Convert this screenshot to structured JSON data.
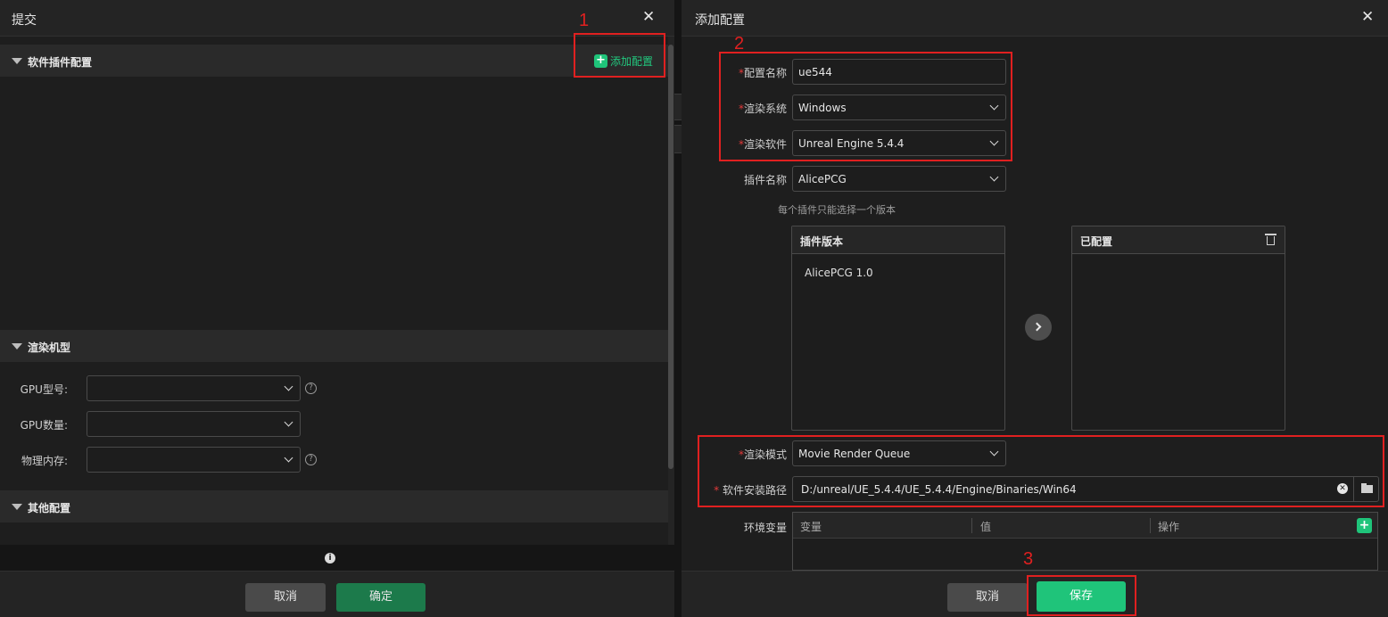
{
  "left": {
    "title": "提交",
    "close_icon": "✕",
    "sections": {
      "software_plugin": "软件插件配置",
      "render_model": "渲染机型",
      "other": "其他配置"
    },
    "add_config_label": "添加配置",
    "fields": {
      "gpu_model": "GPU型号:",
      "gpu_count": "GPU数量:",
      "memory": "物理内存:"
    },
    "help_glyph": "?",
    "info_glyph": "i",
    "cancel_label": "取消",
    "confirm_label": "确定"
  },
  "right": {
    "title": "添加配置",
    "close_icon": "✕",
    "required_mark": "*",
    "fields": {
      "config_name": {
        "label": "配置名称",
        "value": "ue544"
      },
      "render_system": {
        "label": "渲染系统",
        "value": "Windows"
      },
      "render_software": {
        "label": "渲染软件",
        "value": "Unreal Engine 5.4.4"
      },
      "plugin_name": {
        "label": "插件名称",
        "value": "AlicePCG"
      },
      "render_mode": {
        "label": "渲染模式",
        "value": "Movie Render Queue"
      },
      "install_path": {
        "label": "软件安装路径",
        "value": "D:/unreal/UE_5.4.4/UE_5.4.4/Engine/Binaries/Win64"
      },
      "env_vars": {
        "label": "环境变量"
      }
    },
    "hint": "每个插件只能选择一个版本",
    "transfer": {
      "left_title": "插件版本",
      "left_items": [
        "AlicePCG 1.0"
      ],
      "right_title": "已配置"
    },
    "env_table": {
      "columns": [
        "变量",
        "值",
        "操作"
      ],
      "add_glyph": "+"
    },
    "cancel_label": "取消",
    "save_label": "保存"
  },
  "annotations": [
    "1",
    "2",
    "3"
  ],
  "colors": {
    "accent_green": "#1fc47a",
    "annotation_red": "#e02020",
    "required_red": "#e23a3a",
    "panel_bg": "#1e1e1e"
  }
}
